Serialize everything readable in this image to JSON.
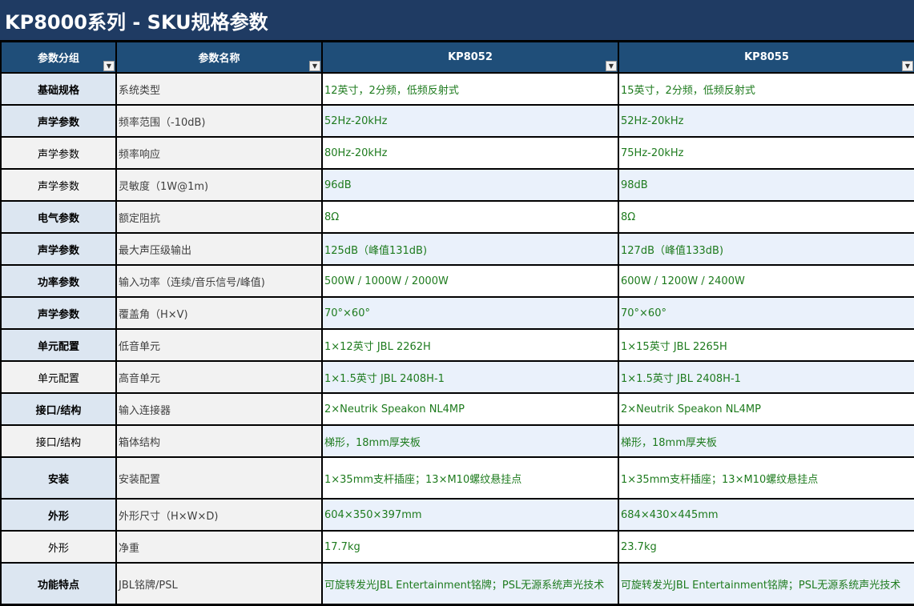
{
  "title": "KP8000系列 - SKU规格参数",
  "headers": [
    "参数分组",
    "参数名称",
    "KP8052",
    "KP8055"
  ],
  "filter_glyph": "▼",
  "rows": [
    {
      "group": "基础规格",
      "name": "系统类型",
      "kp8052": "12英寸，2分频，低频反射式",
      "kp8055": "15英寸，2分频，低频反射式"
    },
    {
      "group": "声学参数",
      "name": "频率范围（-10dB)",
      "kp8052": "52Hz-20kHz",
      "kp8055": "52Hz-20kHz"
    },
    {
      "group": "声学参数",
      "name": "频率响应",
      "kp8052": "80Hz-20kHz",
      "kp8055": "75Hz-20kHz"
    },
    {
      "group": "声学参数",
      "name": "灵敏度（1W@1m)",
      "kp8052": "96dB",
      "kp8055": "98dB"
    },
    {
      "group": "电气参数",
      "name": "额定阻抗",
      "kp8052": "8Ω",
      "kp8055": "8Ω"
    },
    {
      "group": "声学参数",
      "name": "最大声压级输出",
      "kp8052": "125dB（峰值131dB)",
      "kp8055": "127dB（峰值133dB)"
    },
    {
      "group": "功率参数",
      "name": "输入功率（连续/音乐信号/峰值)",
      "kp8052": "500W / 1000W / 2000W",
      "kp8055": "600W / 1200W / 2400W"
    },
    {
      "group": "声学参数",
      "name": "覆盖角（H×V)",
      "kp8052": "70°×60°",
      "kp8055": "70°×60°"
    },
    {
      "group": "单元配置",
      "name": "低音单元",
      "kp8052": "1×12英寸 JBL 2262H",
      "kp8055": "1×15英寸 JBL 2265H"
    },
    {
      "group": "单元配置",
      "name": "高音单元",
      "kp8052": "1×1.5英寸 JBL 2408H-1",
      "kp8055": "1×1.5英寸 JBL 2408H-1"
    },
    {
      "group": "接口/结构",
      "name": "输入连接器",
      "kp8052": "2×Neutrik Speakon NL4MP",
      "kp8055": "2×Neutrik Speakon NL4MP"
    },
    {
      "group": "接口/结构",
      "name": "箱体结构",
      "kp8052": "梯形，18mm厚夹板",
      "kp8055": "梯形，18mm厚夹板"
    },
    {
      "group": "安装",
      "name": "安装配置",
      "kp8052": "1×35mm支杆插座；13×M10螺纹悬挂点",
      "kp8055": "1×35mm支杆插座；13×M10螺纹悬挂点"
    },
    {
      "group": "外形",
      "name": "外形尺寸（H×W×D)",
      "kp8052": "604×350×397mm",
      "kp8055": "684×430×445mm"
    },
    {
      "group": "外形",
      "name": "净重",
      "kp8052": "17.7kg",
      "kp8055": "23.7kg"
    },
    {
      "group": "功能特点",
      "name": "JBL铭牌/PSL",
      "kp8052": "可旋转发光JBL Entertainment铭牌；PSL无源系统声光技术",
      "kp8055": "可旋转发光JBL Entertainment铭牌；PSL无源系统声光技术"
    }
  ]
}
